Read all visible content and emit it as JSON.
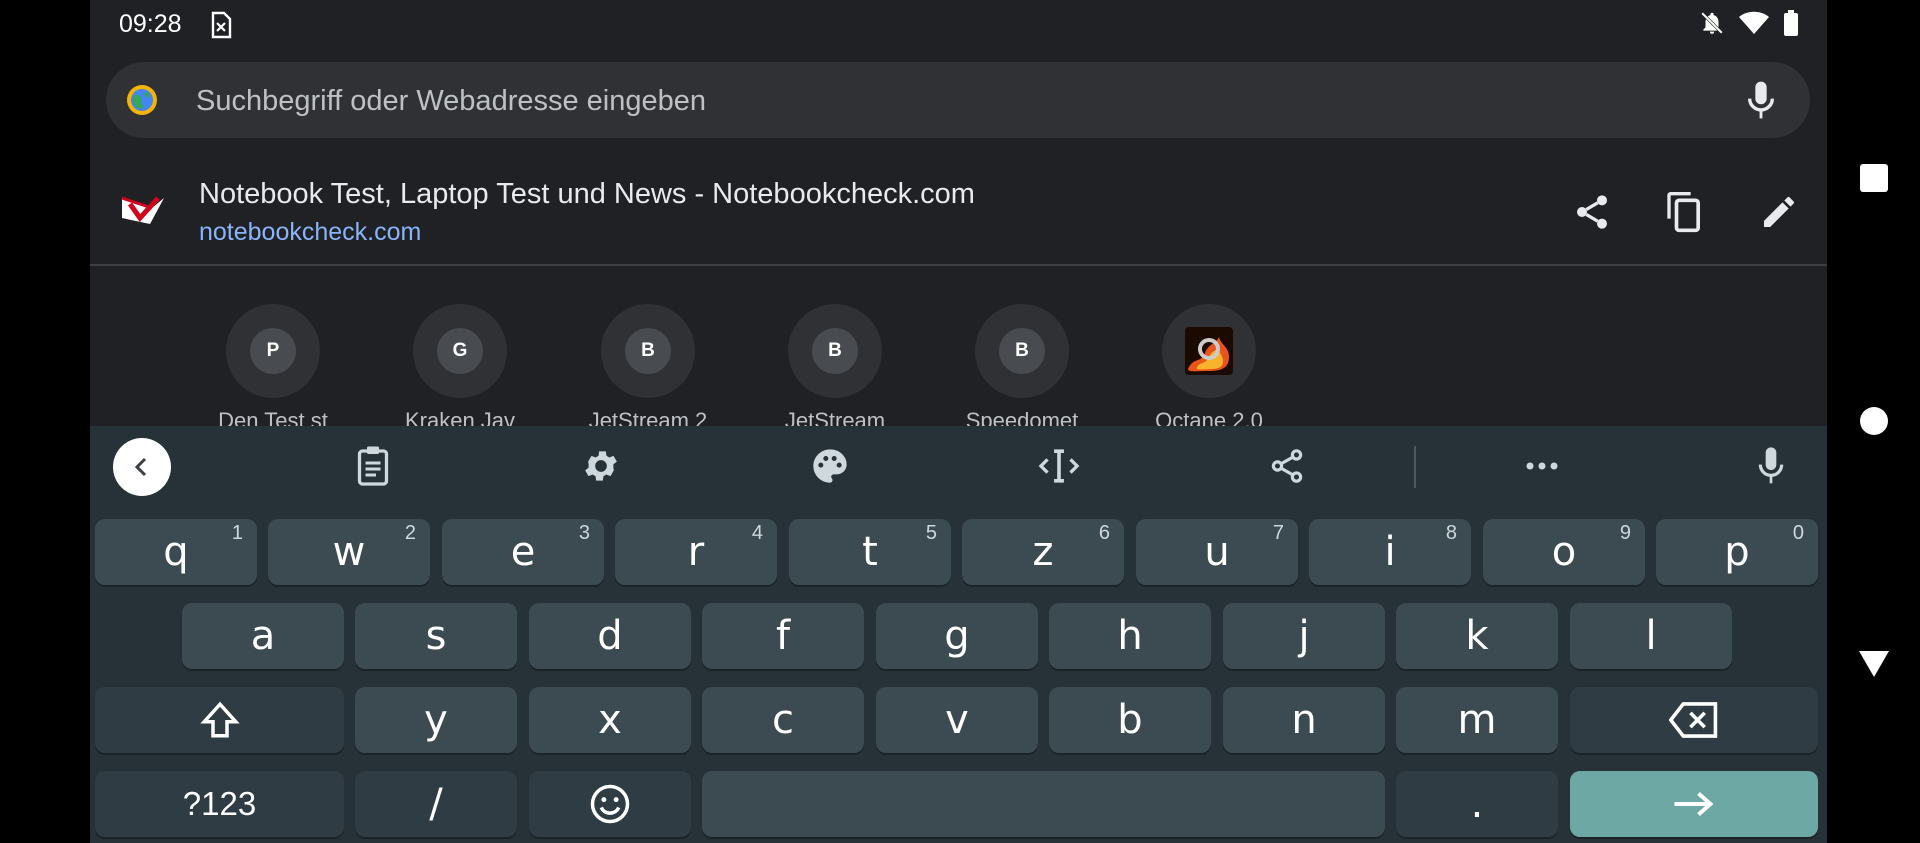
{
  "status": {
    "time": "09:28"
  },
  "omnibox": {
    "placeholder": "Suchbegriff oder Webadresse eingeben"
  },
  "suggestion": {
    "title": "Notebook Test, Laptop Test und News - Notebookcheck.com",
    "url": "notebookcheck.com"
  },
  "tiles": [
    {
      "letter": "P",
      "label": "Den Test st"
    },
    {
      "letter": "G",
      "label": "Kraken Jav"
    },
    {
      "letter": "B",
      "label": "JetStream 2"
    },
    {
      "letter": "B",
      "label": "JetStream"
    },
    {
      "letter": "B",
      "label": "Speedomet"
    },
    {
      "letter": "",
      "label": "Octane 2.0"
    }
  ],
  "keyboard": {
    "row1": [
      {
        "k": "q",
        "h": "1"
      },
      {
        "k": "w",
        "h": "2"
      },
      {
        "k": "e",
        "h": "3"
      },
      {
        "k": "r",
        "h": "4"
      },
      {
        "k": "t",
        "h": "5"
      },
      {
        "k": "z",
        "h": "6"
      },
      {
        "k": "u",
        "h": "7"
      },
      {
        "k": "i",
        "h": "8"
      },
      {
        "k": "o",
        "h": "9"
      },
      {
        "k": "p",
        "h": "0"
      }
    ],
    "row2": [
      "a",
      "s",
      "d",
      "f",
      "g",
      "h",
      "j",
      "k",
      "l"
    ],
    "row3": [
      "y",
      "x",
      "c",
      "v",
      "b",
      "n",
      "m"
    ],
    "symbols_label": "?123",
    "slash": "/",
    "period": "."
  },
  "colors": {
    "background": "#202124",
    "keyboard": "#263238",
    "key": "#3c4a52",
    "enter_key": "#6ea8a4",
    "link": "#8ab4f8"
  },
  "icons": {
    "toolbar": [
      "back-icon",
      "clipboard-icon",
      "settings-icon",
      "palette-icon",
      "text-cursor-icon",
      "share-icon",
      "more-icon",
      "mic-icon"
    ],
    "suggestion_actions": [
      "share-icon",
      "copy-icon",
      "edit-icon"
    ],
    "nav": [
      "recents-icon",
      "home-icon",
      "back-icon"
    ]
  }
}
